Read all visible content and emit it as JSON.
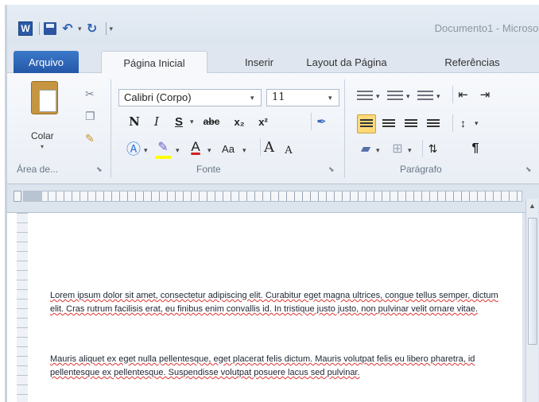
{
  "window": {
    "title": "Documento1 - Microsof"
  },
  "tabs": [
    {
      "label": "Arquivo"
    },
    {
      "label": "Página Inicial"
    },
    {
      "label": "Inserir"
    },
    {
      "label": "Layout da Página"
    },
    {
      "label": "Referências"
    }
  ],
  "ribbon": {
    "clipboard": {
      "paste_label": "Colar",
      "group_label": "Área de..."
    },
    "font": {
      "font_name": "Calibri (Corpo)",
      "font_size": "11",
      "bold": "N",
      "italic": "I",
      "underline": "S",
      "strike": "abc",
      "subscript": "x₂",
      "superscript": "x²",
      "grow": "A",
      "shrink": "A",
      "change_case": "Aa",
      "group_label": "Fonte"
    },
    "paragraph": {
      "pilcrow": "¶",
      "group_label": "Parágrafo"
    }
  },
  "document": {
    "paragraphs": [
      "Lorem ipsum dolor sit amet, consectetur adipiscing elit. Curabitur eget magna ultrices, congue tellus semper, dictum elit. Cras rutrum facilisis erat, eu finibus enim convallis id. In tristique justo justo, non pulvinar velit ornare vitae.",
      "Mauris aliquet ex eget nulla pellentesque, eget placerat felis dictum. Mauris volutpat felis eu libero pharetra, id pellentesque ex pellentesque. Suspendisse volutpat posuere lacus sed pulvinar."
    ]
  },
  "colors": {
    "file_tab": "#2a61b4",
    "highlight": "#ffff00",
    "font_color": "#d21f1f",
    "active_align": "#ffd978"
  }
}
